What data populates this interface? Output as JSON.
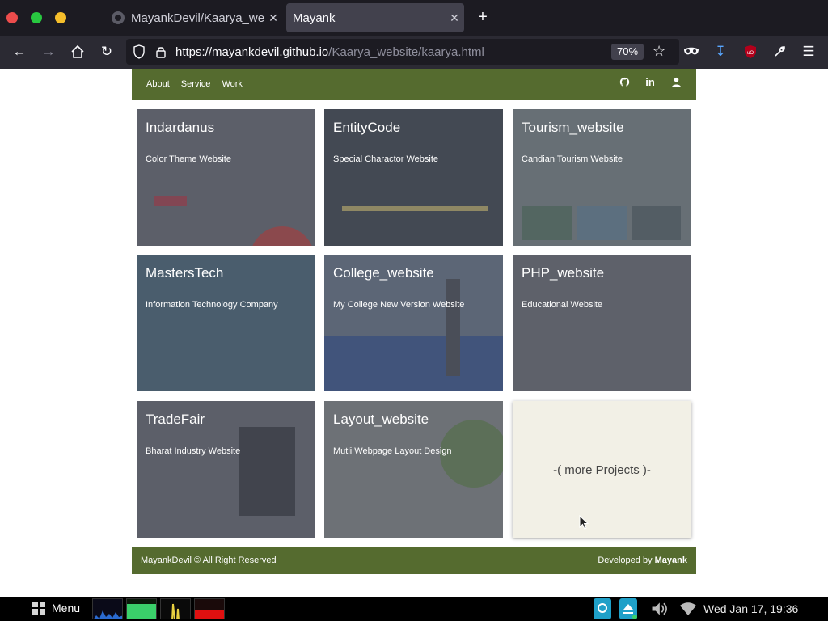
{
  "browser": {
    "tabs": [
      {
        "title": "MayankDevil/Kaarya_web",
        "active": false
      },
      {
        "title": "Mayank",
        "active": true
      }
    ],
    "url_domain": "https://mayankdevil.github.io",
    "url_path": "/Kaarya_website/kaarya.html",
    "zoom": "70%"
  },
  "site": {
    "nav_links": [
      "About",
      "Service",
      "Work"
    ],
    "nav_icons": [
      "github-icon",
      "linkedin-icon",
      "user-icon"
    ],
    "projects": [
      {
        "name": "Indardanus",
        "desc": "Color Theme Website"
      },
      {
        "name": "EntityCode",
        "desc": "Special Charactor Website"
      },
      {
        "name": "Tourism_website",
        "desc": "Candian Tourism Website"
      },
      {
        "name": "MastersTech",
        "desc": "Information Technology Company"
      },
      {
        "name": "College_website",
        "desc": "My College New Version Website"
      },
      {
        "name": "PHP_website",
        "desc": "Educational Website"
      },
      {
        "name": "TradeFair",
        "desc": "Bharat Industry Website"
      },
      {
        "name": "Layout_website",
        "desc": "Mutli Webpage Layout Design"
      }
    ],
    "more_label": "-( more Projects )-",
    "footer_left": "MayankDevil © All Right Reserved",
    "footer_right_prefix": "Developed by ",
    "footer_right_name": "Mayank"
  },
  "colors": {
    "brand_green": "#556b2f",
    "card_overlay": "#4b4e57",
    "more_card_bg": "#f2f0e6"
  },
  "taskbar": {
    "menu_label": "Menu",
    "clock": "Wed Jan 17, 19:36"
  }
}
